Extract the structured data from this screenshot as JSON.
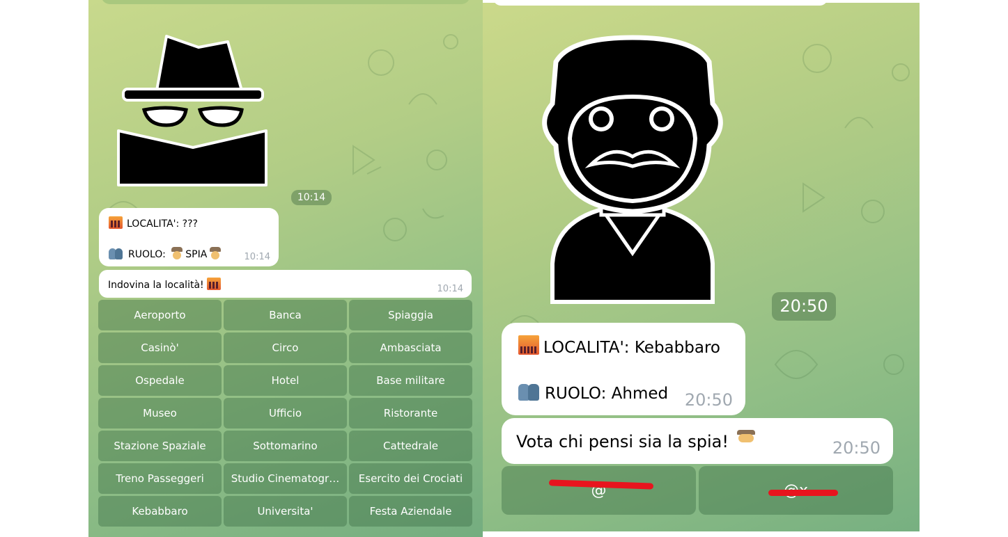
{
  "left": {
    "sticker_time": "10:14",
    "info": {
      "location_label": "LOCALITA': ???",
      "role_label": "RUOLO:",
      "role_value": "SPIA",
      "time": "10:14"
    },
    "prompt": {
      "text": "Indovina la località!",
      "time": "10:14"
    },
    "keyboard": [
      "Aeroporto",
      "Banca",
      "Spiaggia",
      "Casinò'",
      "Circo",
      "Ambasciata",
      "Ospedale",
      "Hotel",
      "Base militare",
      "Museo",
      "Ufficio",
      "Ristorante",
      "Stazione Spaziale",
      "Sottomarino",
      "Cattedrale",
      "Treno Passeggeri",
      "Studio Cinematogr…",
      "Esercito dei Crociati",
      "Kebabbaro",
      "Universita'",
      "Festa Aziendale"
    ]
  },
  "right": {
    "sticker_time": "20:50",
    "info": {
      "location_label": "LOCALITA': Kebabbaro",
      "role_label": "RUOLO: Ahmed",
      "time": "20:50"
    },
    "prompt": {
      "text": "Vota chi pensi sia la spia!",
      "time": "20:50"
    },
    "vote_buttons": [
      "@",
      "@x"
    ]
  },
  "icons": {
    "spy_sticker": "spy-sticker-icon",
    "man_sticker": "man-mustache-sticker-icon",
    "city": "cityscape-emoji-icon",
    "people": "busts-emoji-icon",
    "spy": "detective-emoji-icon"
  },
  "colors": {
    "bubble": "#ffffff",
    "key_bg": "#3c6e46",
    "bg_top": "#c8d98c",
    "bg_bottom": "#74ad80",
    "redaction": "#e8141e"
  }
}
